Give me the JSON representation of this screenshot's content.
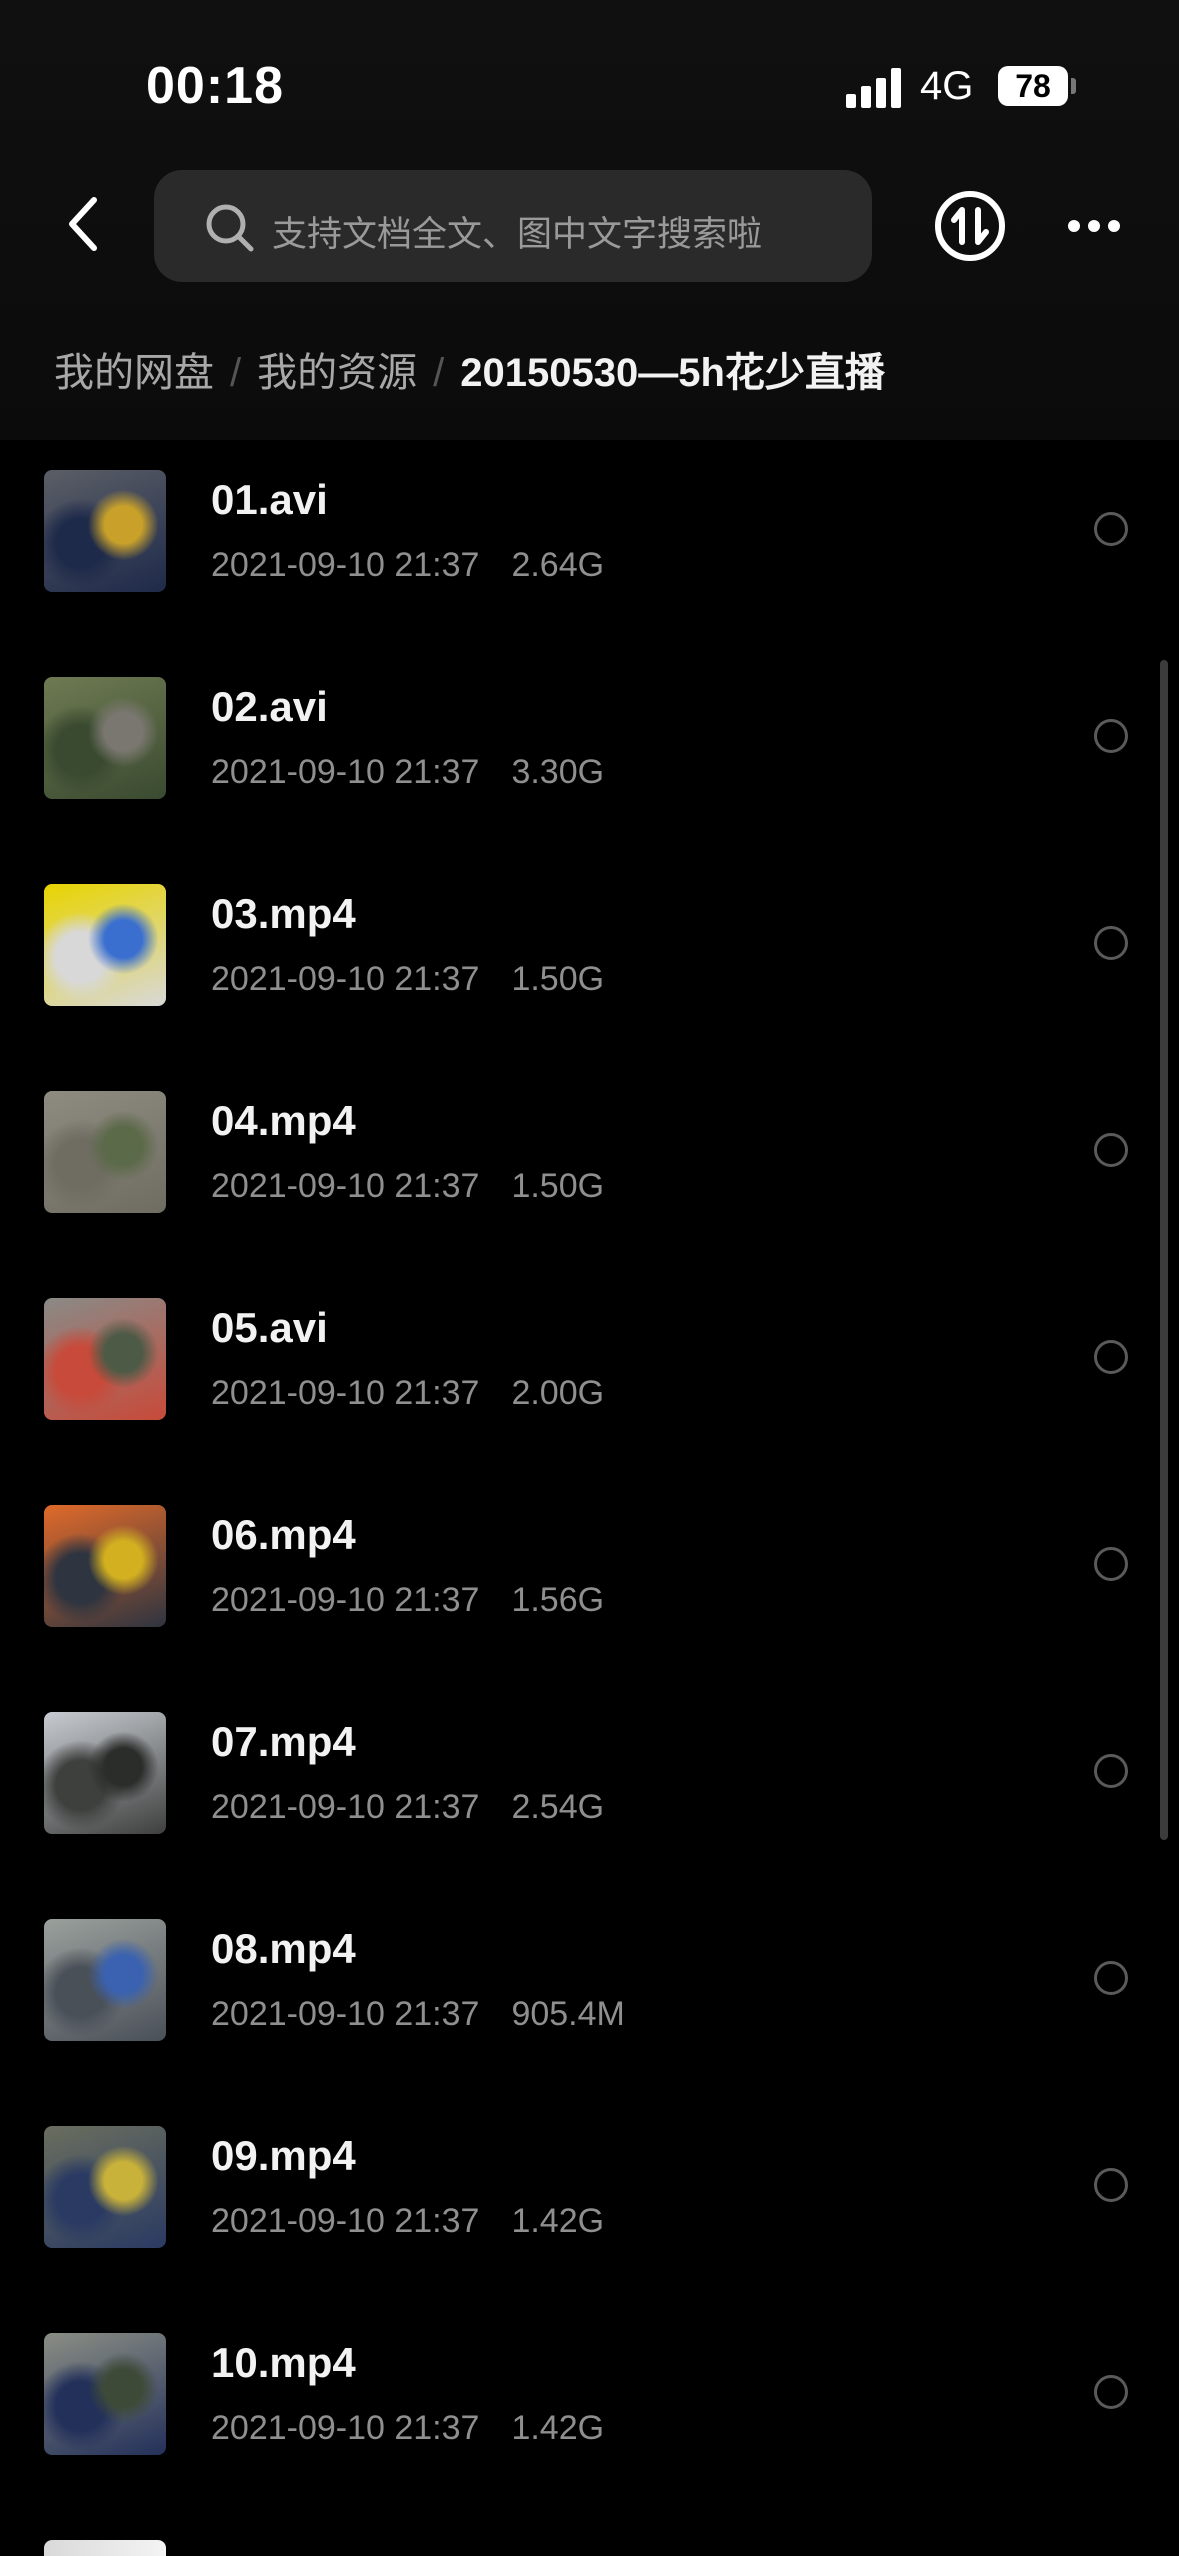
{
  "status_bar": {
    "time": "00:18",
    "network": "4G",
    "battery": "78"
  },
  "top_bar": {
    "search_placeholder": "支持文档全文、图中文字搜索啦"
  },
  "breadcrumb": {
    "items": [
      "我的网盘",
      "我的资源"
    ],
    "separator": "/",
    "current": "20150530—5h花少直播"
  },
  "files": [
    {
      "name": "01.avi",
      "date": "2021-09-10 21:37",
      "size": "2.64G",
      "thumb_colors": [
        "#5b5e66",
        "#1e2a4a",
        "#c9a12a"
      ]
    },
    {
      "name": "02.avi",
      "date": "2021-09-10 21:37",
      "size": "3.30G",
      "thumb_colors": [
        "#6e7a52",
        "#3a4a30",
        "#7a7770"
      ]
    },
    {
      "name": "03.mp4",
      "date": "2021-09-10 21:37",
      "size": "1.50G",
      "thumb_colors": [
        "#e8d400",
        "#d8d8d8",
        "#3a6fd0"
      ]
    },
    {
      "name": "04.mp4",
      "date": "2021-09-10 21:37",
      "size": "1.50G",
      "thumb_colors": [
        "#8e8b80",
        "#6f6c62",
        "#5b6a48"
      ]
    },
    {
      "name": "05.avi",
      "date": "2021-09-10 21:37",
      "size": "2.00G",
      "thumb_colors": [
        "#8a8a86",
        "#c84a3a",
        "#4d5a46"
      ]
    },
    {
      "name": "06.mp4",
      "date": "2021-09-10 21:37",
      "size": "1.56G",
      "thumb_colors": [
        "#e06a2a",
        "#2e3440",
        "#d2b020"
      ]
    },
    {
      "name": "07.mp4",
      "date": "2021-09-10 21:37",
      "size": "2.54G",
      "thumb_colors": [
        "#c8ccd2",
        "#3e403e",
        "#2b2d2b"
      ]
    },
    {
      "name": "08.mp4",
      "date": "2021-09-10 21:37",
      "size": "905.4M",
      "thumb_colors": [
        "#9aa09c",
        "#4a5058",
        "#3a62b0"
      ]
    },
    {
      "name": "09.mp4",
      "date": "2021-09-10 21:37",
      "size": "1.42G",
      "thumb_colors": [
        "#6a6e5e",
        "#2a3a62",
        "#c9b23a"
      ]
    },
    {
      "name": "10.mp4",
      "date": "2021-09-10 21:37",
      "size": "1.42G",
      "thumb_colors": [
        "#8a8e84",
        "#23305a",
        "#3e4a38"
      ]
    }
  ],
  "colors": {
    "background": "#000000",
    "search_bg": "#2a2a2a",
    "text_primary": "#f2f2f2",
    "text_secondary": "#8f8f8f"
  },
  "icons": [
    "back-icon",
    "search-icon",
    "sort-icon",
    "more-icon",
    "radio-icon"
  ]
}
